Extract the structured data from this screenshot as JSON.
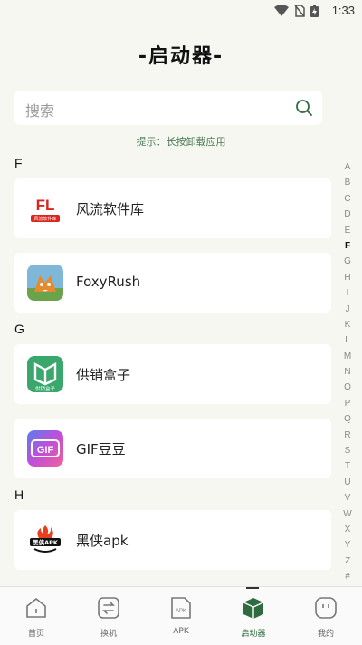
{
  "status": {
    "time": "1:33"
  },
  "header": {
    "title": "-启动器-"
  },
  "search": {
    "placeholder": "搜索"
  },
  "hint": "提示：长按卸载应用",
  "sections": [
    {
      "letter": "F",
      "apps": [
        {
          "name": "风流软件库",
          "icon": "fl-logo-icon"
        },
        {
          "name": "FoxyRush",
          "icon": "foxyrush-icon"
        }
      ]
    },
    {
      "letter": "G",
      "apps": [
        {
          "name": "供销盒子",
          "icon": "gongxiao-box-icon"
        },
        {
          "name": "GIF豆豆",
          "icon": "gif-doudou-icon"
        }
      ]
    },
    {
      "letter": "H",
      "apps": [
        {
          "name": "黑侠apk",
          "icon": "heixia-apk-icon"
        }
      ]
    }
  ],
  "icon_text": {
    "fl": "FL",
    "fl_sub": "风流软件库",
    "gx_sub": "供销盒子",
    "gif": "GIF",
    "hx": "黑侠APK"
  },
  "alphabet": [
    "A",
    "B",
    "C",
    "D",
    "E",
    "F",
    "G",
    "H",
    "I",
    "J",
    "K",
    "L",
    "M",
    "N",
    "O",
    "P",
    "Q",
    "R",
    "S",
    "T",
    "U",
    "V",
    "W",
    "X",
    "Y",
    "Z",
    "#"
  ],
  "alphabet_active": "F",
  "nav": [
    {
      "label": "首页",
      "icon": "home-icon"
    },
    {
      "label": "换机",
      "icon": "swap-icon"
    },
    {
      "label": "APK",
      "icon": "apk-file-icon"
    },
    {
      "label": "启动器",
      "icon": "launcher-box-icon",
      "active": true
    },
    {
      "label": "我的",
      "icon": "profile-face-icon"
    }
  ],
  "colors": {
    "accent": "#2f6b3f",
    "background": "#f7f7f2"
  }
}
